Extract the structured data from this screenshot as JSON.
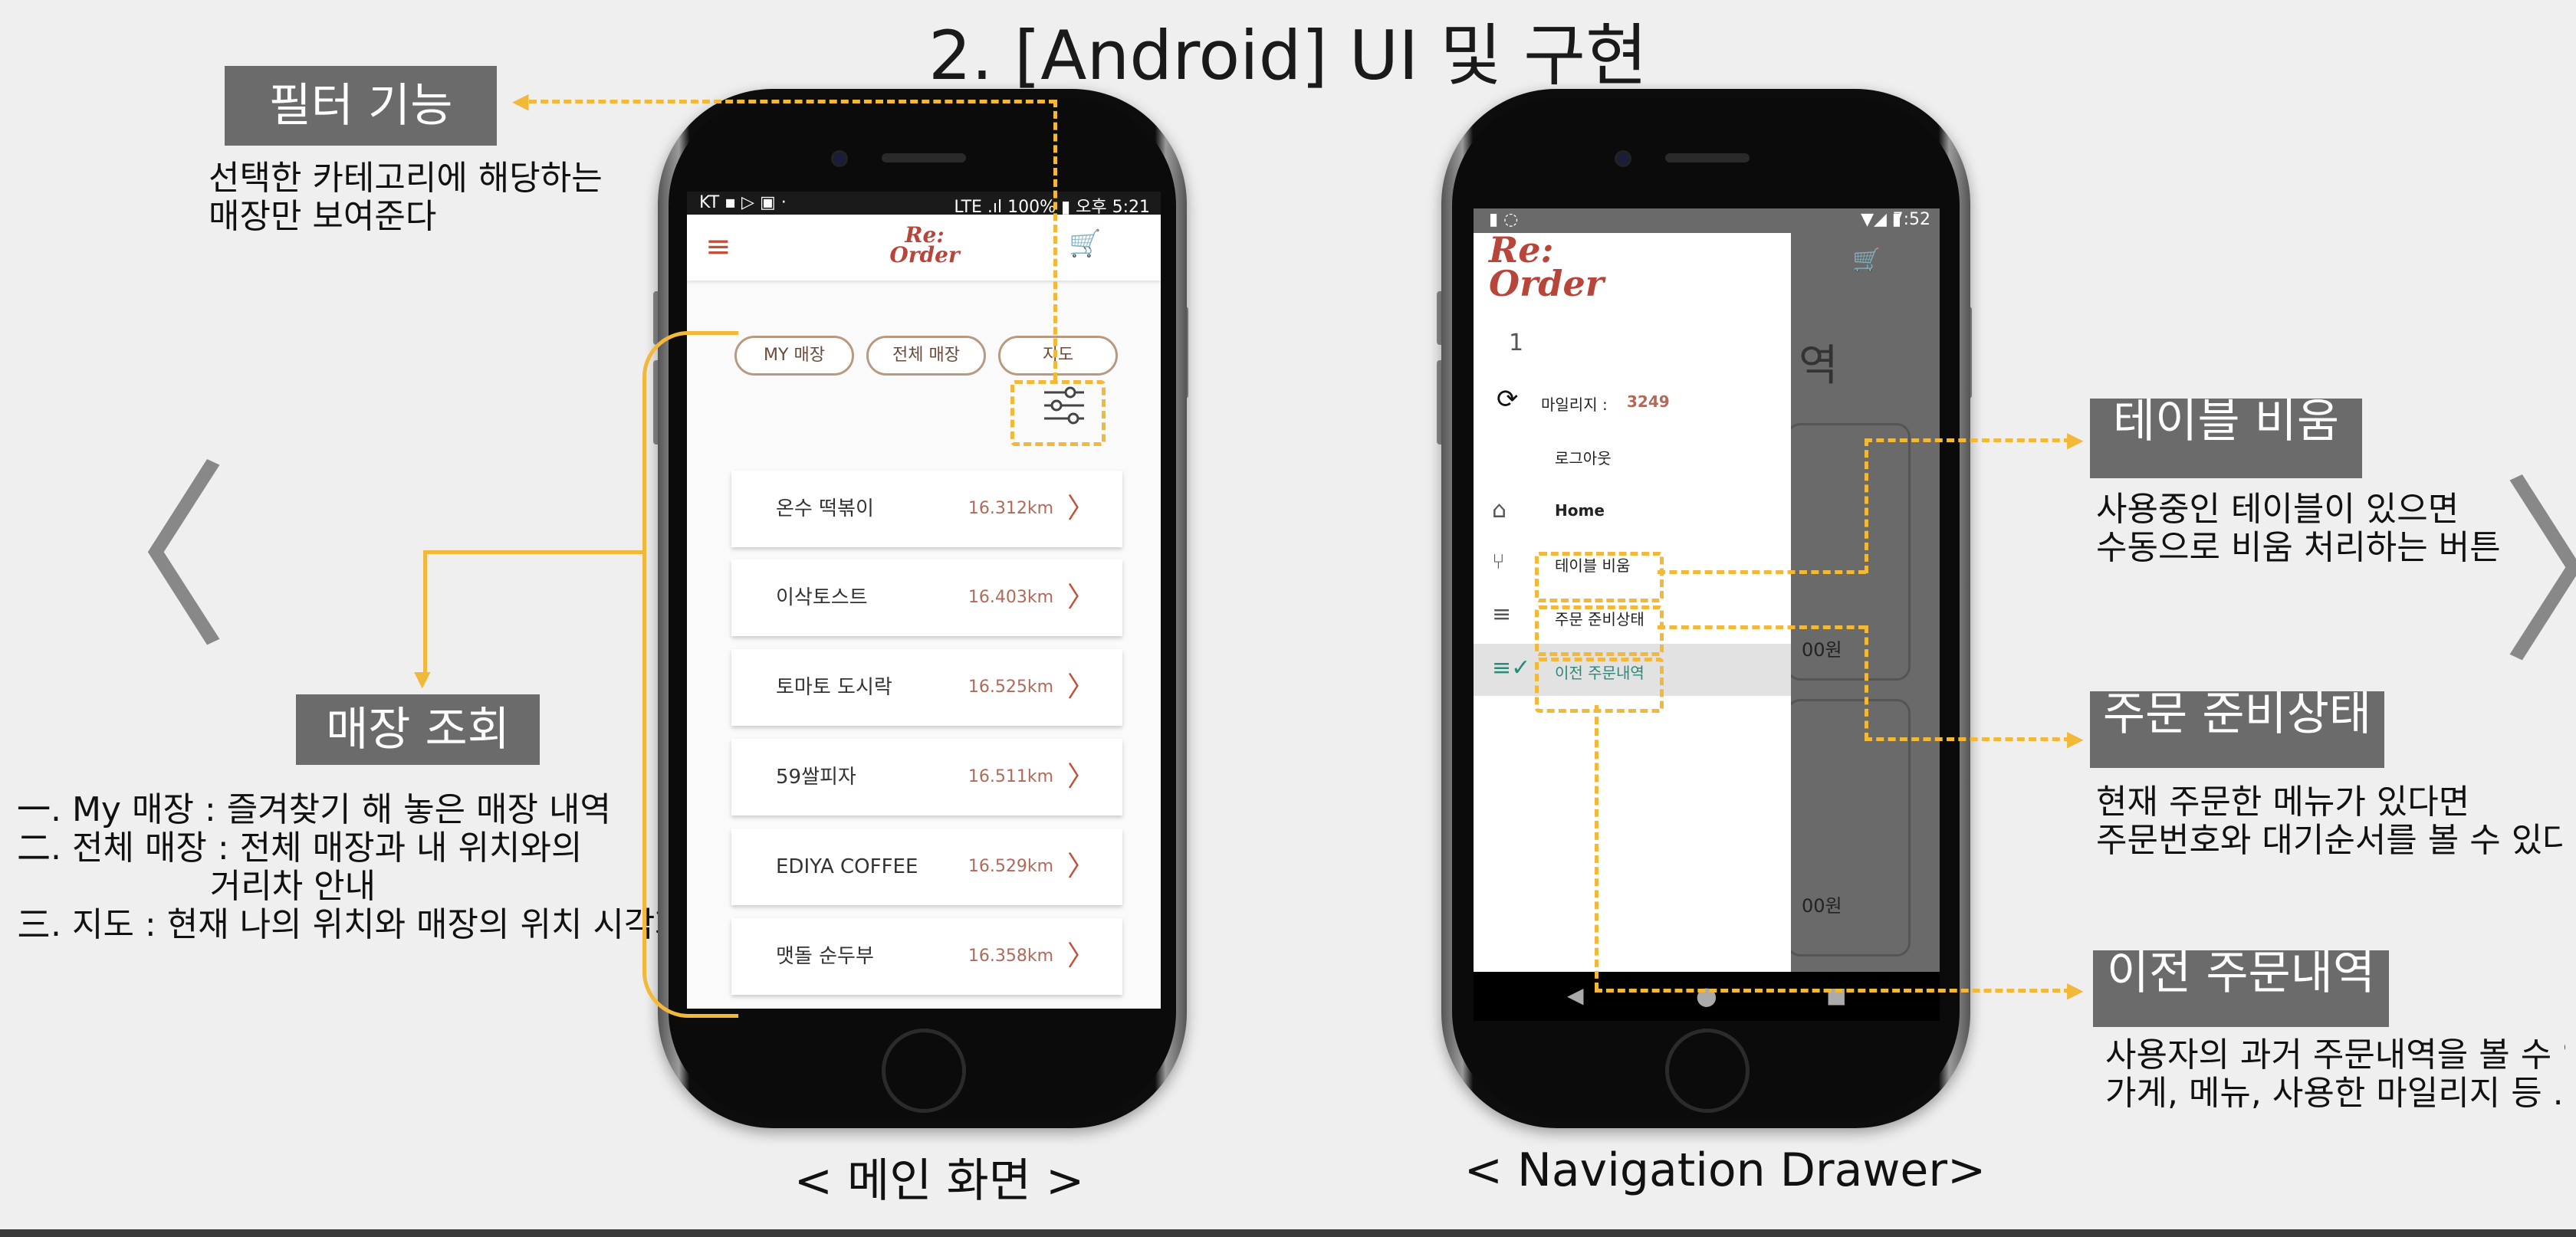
{
  "slide": {
    "title": "2. [Android] UI 및 구현"
  },
  "callouts": {
    "filter": {
      "title": "필터 기능",
      "desc": "선택한 카테고리에 해당하는\n매장만 보여준다"
    },
    "store": {
      "title": "매장 조회",
      "desc": "一. My 매장 : 즐겨찾기 해 놓은 매장 내역\n二. 전체 매장 : 전체 매장과 내 위치와의\n                  거리차 안내\n三. 지도 : 현재 나의 위치와 매장의 위치 시각화"
    },
    "table": {
      "title": "테이블 비움",
      "desc": "사용중인 테이블이 있으면\n수동으로 비움 처리하는 버튼"
    },
    "order_status": {
      "title": "주문 준비상태",
      "desc": "현재 주문한 메뉴가 있다면\n주문번호와 대기순서를 볼 수 있다"
    },
    "history": {
      "title": "이전 주문내역",
      "desc": "사용자의 과거 주문내역을 볼 수 있다\n가게, 메뉴, 사용한 마일리지 등 ."
    }
  },
  "main_screen": {
    "caption": "< 메인 화면 >",
    "status_left": "KT ▪ ▷ ▣ ·",
    "status_right": "LTE .ıl 100% ▮ 오후 5:21",
    "logo_top": "Re:",
    "logo_bottom": "Order",
    "tabs": [
      "MY 매장",
      "전체 매장",
      "지도"
    ],
    "stores": [
      {
        "name": "온수 떡볶이",
        "distance": "16.312km"
      },
      {
        "name": "이삭토스트",
        "distance": "16.403km"
      },
      {
        "name": "토마토 도시락",
        "distance": "16.525km"
      },
      {
        "name": "59쌀피자",
        "distance": "16.511km"
      },
      {
        "name": "EDIYA COFFEE",
        "distance": "16.529km"
      },
      {
        "name": "맷돌 순두부",
        "distance": "16.358km"
      }
    ]
  },
  "drawer_screen": {
    "caption": "< Navigation Drawer>",
    "status_time": "7:52",
    "logo_top": "Re:",
    "logo_bottom": "Order",
    "user_number": "1",
    "mileage_label": "마일리지 :",
    "mileage_value": "3249",
    "logout": "로그아웃",
    "items": [
      "Home",
      "테이블 비움",
      "주문 준비상태",
      "이전 주문내역"
    ],
    "bg_text": [
      "역",
      "00원",
      "00원"
    ]
  },
  "colors": {
    "accent": "#f2b83a",
    "callout_bg": "#6b6b6b",
    "brand": "#b8453a"
  }
}
